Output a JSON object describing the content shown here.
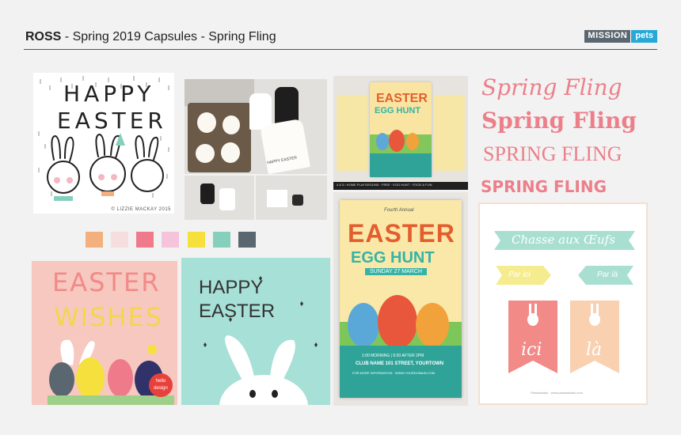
{
  "header": {
    "brand": "ROSS",
    "subtitle": " - Spring 2019 Capsules - Spring Fling",
    "logo_left": "MISSION",
    "logo_right": "pets"
  },
  "happy_easter": {
    "line1": "HAPPY",
    "line2": "EASTER",
    "credit": "© LIZZIE MACKAY 2015"
  },
  "tag_photo": {
    "tag_text": "HAPPY EASTER"
  },
  "swatches": [
    "#f3b07c",
    "#f7dede",
    "#ef7a8a",
    "#f6c4da",
    "#f5e03d",
    "#86cfbd",
    "#5b6770"
  ],
  "flyer_small": {
    "l1": "EASTER",
    "l2": "EGG HUNT",
    "footer": "4 & 5 / HOME PLAYGROUND  ·  FREE  ·  EGG HUNT  ·  FOOD & FUN"
  },
  "flyer_large": {
    "pre": "Fourth Annual",
    "l1": "EASTER",
    "l2": "EGG HUNT",
    "date": "SUNDAY 27 MARCH",
    "info1": "1:00 MORNING  |  6:00 AFTER 2PM",
    "info2": "CLUB NAME  101 STREET, YOURTOWN",
    "info3": "FOR MORE INFORMATION  ·  WWW.YOURDOMAIN.COM"
  },
  "spring_fling": [
    "Spring Fling",
    "Spring Fling",
    "SPRING FLING",
    "SPRING FLING"
  ],
  "easter_wishes": {
    "l1": "EASTER",
    "l2": "WISHES",
    "badge": "hello design"
  },
  "bunny_card": {
    "l1": "HAPPY",
    "l2": "EASTER"
  },
  "chasse": {
    "banner": "Chasse aux Œufs",
    "arrow1": "Par ici",
    "arrow2": "Par là",
    "flag1": "ici",
    "flag2": "là",
    "footer": "Pandastudio · www.pandastudio.com"
  },
  "colors": {
    "pink": "#ec7f8a",
    "teal": "#86cfbd",
    "yellow": "#f5e03d"
  }
}
